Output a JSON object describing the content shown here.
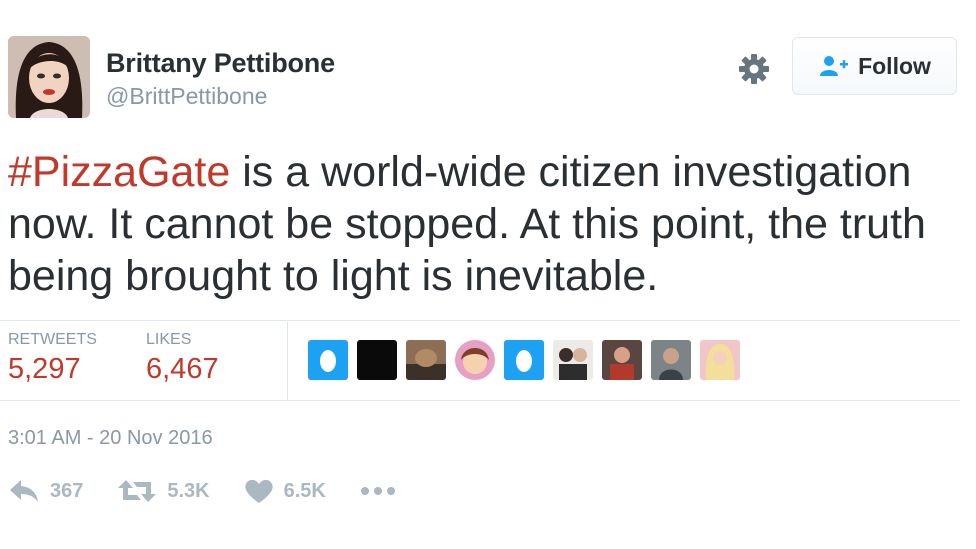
{
  "user": {
    "name": "Brittany Pettibone",
    "handle": "@BrittPettibone"
  },
  "follow_button": {
    "label": "Follow"
  },
  "tweet": {
    "hashtag": "#PizzaGate",
    "text": " is a world-wide citizen investigation now. It cannot be stopped. At this point, the truth being brought to light is inevitable."
  },
  "stats": {
    "retweets_label": "RETWEETS",
    "retweets_value": "5,297",
    "likes_label": "LIKES",
    "likes_value": "6,467"
  },
  "timestamp": "3:01 AM - 20 Nov 2016",
  "actions": {
    "reply_count": "367",
    "retweet_count": "5.3K",
    "like_count": "6.5K"
  },
  "colors": {
    "hashtag": "#c0392b",
    "stat_value": "#c0392b",
    "muted": "#8899a6",
    "egg_blue": "#1da1f2"
  },
  "icons": {
    "settings": "gear-icon",
    "follow": "add-user-icon",
    "reply": "reply-icon",
    "retweet": "retweet-icon",
    "like": "heart-icon",
    "more": "more-icon"
  }
}
